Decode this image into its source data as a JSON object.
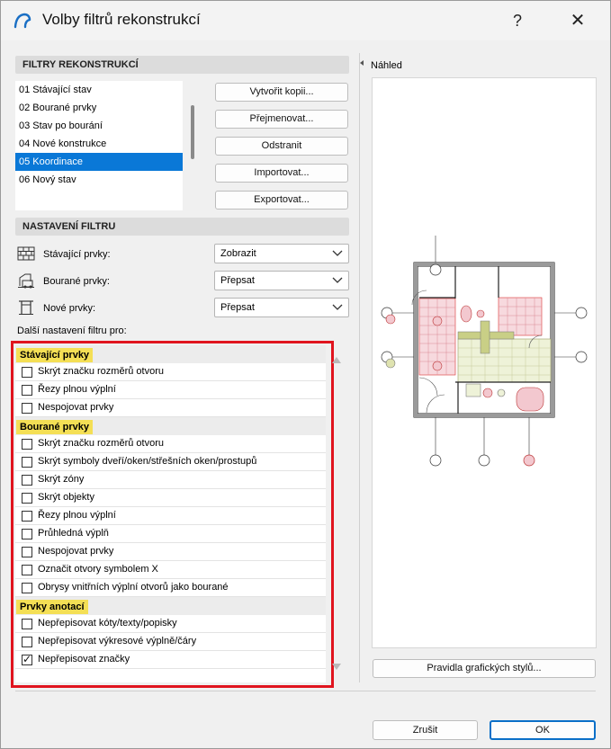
{
  "window": {
    "title": "Volby filtrů rekonstrukcí",
    "help": "?",
    "close": "✕"
  },
  "filters_section": {
    "header": "FILTRY REKONSTRUKCÍ",
    "items": [
      "01 Stávající stav",
      "02 Bourané prvky",
      "03 Stav po bourání",
      "04 Nové konstrukce",
      "05 Koordinace",
      "06 Nový stav"
    ],
    "selected_index": 4,
    "buttons": {
      "copy": "Vytvořit kopii...",
      "rename": "Přejmenovat...",
      "delete": "Odstranit",
      "import": "Importovat...",
      "export": "Exportovat..."
    }
  },
  "settings_section": {
    "header": "NASTAVENÍ FILTRU",
    "rows": [
      {
        "label": "Stávající prvky:",
        "value": "Zobrazit",
        "icon": "existing-elements-icon"
      },
      {
        "label": "Bourané prvky:",
        "value": "Přepsat",
        "icon": "demolished-elements-icon"
      },
      {
        "label": "Nové prvky:",
        "value": "Přepsat",
        "icon": "new-elements-icon"
      }
    ],
    "more_label": "Další nastavení filtru pro:"
  },
  "checkbox_groups": [
    {
      "title": "Stávající prvky",
      "items": [
        {
          "label": "Skrýt značku rozměrů otvoru",
          "checked": false
        },
        {
          "label": "Řezy plnou výplní",
          "checked": false
        },
        {
          "label": "Nespojovat prvky",
          "checked": false
        }
      ]
    },
    {
      "title": "Bourané prvky",
      "items": [
        {
          "label": "Skrýt značku rozměrů otvoru",
          "checked": false
        },
        {
          "label": "Skrýt symboly dveří/oken/střešních oken/prostupů",
          "checked": false
        },
        {
          "label": "Skrýt zóny",
          "checked": false
        },
        {
          "label": "Skrýt objekty",
          "checked": false
        },
        {
          "label": "Řezy plnou výplní",
          "checked": false
        },
        {
          "label": "Průhledná výplň",
          "checked": false
        },
        {
          "label": "Nespojovat prvky",
          "checked": false
        },
        {
          "label": "Označit otvory symbolem X",
          "checked": false
        },
        {
          "label": "Obrysy vnitřních výplní otvorů jako bourané",
          "checked": false
        }
      ]
    },
    {
      "title": "Prvky anotací",
      "items": [
        {
          "label": "Nepřepisovat kóty/texty/popisky",
          "checked": false
        },
        {
          "label": "Nepřepisovat výkresové výplně/čáry",
          "checked": false
        },
        {
          "label": "Nepřepisovat značky",
          "checked": true
        }
      ]
    }
  ],
  "preview": {
    "label": "Náhled",
    "graphic_styles_button": "Pravidla grafických stylů..."
  },
  "footer": {
    "cancel": "Zrušit",
    "ok": "OK"
  },
  "colors": {
    "accent": "#0a78d7",
    "highlight_frame": "#e0141e",
    "group_title_bg": "#f4df55"
  }
}
